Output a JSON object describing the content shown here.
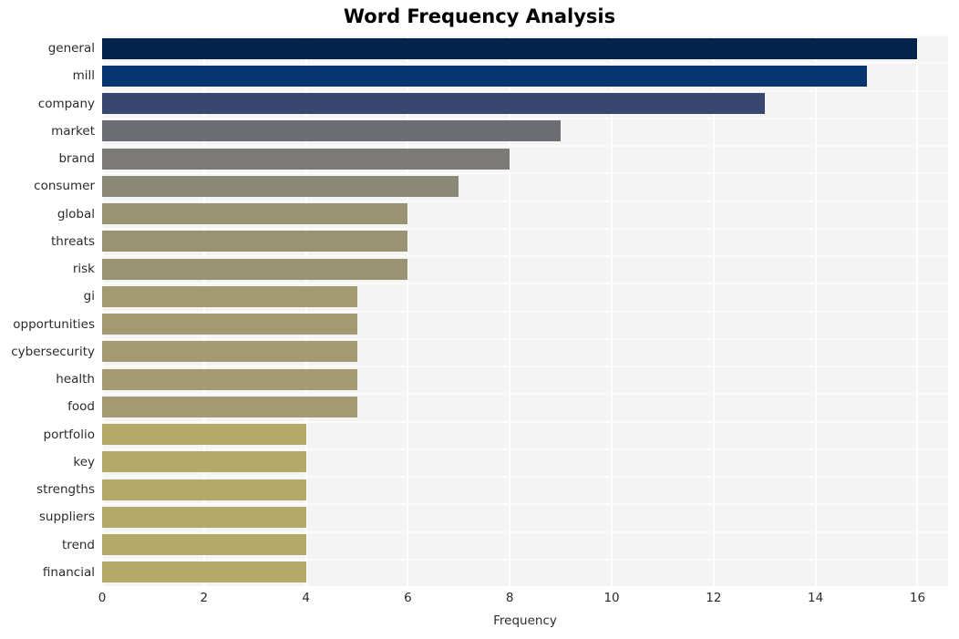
{
  "chart_data": {
    "type": "bar",
    "orientation": "horizontal",
    "title": "Word Frequency Analysis",
    "xlabel": "Frequency",
    "ylabel": "",
    "categories": [
      "general",
      "mill",
      "company",
      "market",
      "brand",
      "consumer",
      "global",
      "threats",
      "risk",
      "gi",
      "opportunities",
      "cybersecurity",
      "health",
      "food",
      "portfolio",
      "key",
      "strengths",
      "suppliers",
      "trend",
      "financial"
    ],
    "values": [
      16,
      15,
      13,
      9,
      8,
      7,
      6,
      6,
      6,
      5,
      5,
      5,
      5,
      5,
      4,
      4,
      4,
      4,
      4,
      4
    ],
    "bar_colors": [
      "#04234c",
      "#05346e",
      "#374770",
      "#6b6d73",
      "#7b7a77",
      "#8b8878",
      "#9a9373",
      "#9a9373",
      "#9a9373",
      "#a39a71",
      "#a39a71",
      "#a39a71",
      "#a39a71",
      "#a39a71",
      "#b5a96a",
      "#b5a96a",
      "#b5a96a",
      "#b5a96a",
      "#b5a96a",
      "#b5a96a"
    ],
    "xlim": [
      0,
      16.6
    ],
    "xticks": [
      0,
      2,
      4,
      6,
      8,
      10,
      12,
      14,
      16
    ],
    "xtick_labels": [
      "0",
      "2",
      "4",
      "6",
      "8",
      "10",
      "12",
      "14",
      "16"
    ],
    "grid": true,
    "grid_axis": "both",
    "grid_color": "#ffffff",
    "plot_background": "#f4f4f5",
    "figure_background": "#ffffff",
    "legend": null,
    "legend_position": "none"
  }
}
